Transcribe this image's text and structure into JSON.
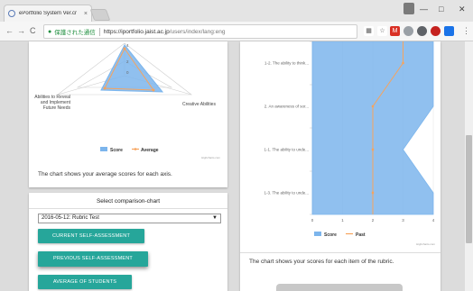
{
  "browser": {
    "tab_title": "ePortfolio System Ver.cr",
    "tab_close": "×",
    "minimize": "—",
    "maximize": "□",
    "close": "✕",
    "back": "←",
    "forward": "→",
    "reload": "C",
    "secure_label": "保護された通信",
    "url_host": "https://iportfolio.jaist.ac.jp",
    "url_path": "/users/index/lang:eng",
    "menu": "⋮"
  },
  "radar_card": {
    "labels": [
      "Abilities to Reveal and Implement Future Needs",
      "Creative Abilities"
    ],
    "label_lines_left": [
      "Abilities to Reveal",
      "and Implement",
      "Future Needs"
    ],
    "label_right": "Creative Abilities",
    "tick_labels": [
      "4",
      "2",
      "0"
    ],
    "legend": [
      {
        "name": "Score",
        "color": "#7cb5ec"
      },
      {
        "name": "Average",
        "color": "#f7a35c"
      }
    ],
    "credit": "Highcharts.com",
    "caption": "The chart shows your average scores for each axis."
  },
  "compare_card": {
    "title": "Select comparison-chart",
    "selected_option": "2016-05-12: Rubric Test",
    "buttons": [
      "CURRENT SELF-ASSESSMENT",
      "PREVIOUS SELF-ASSESSMENT",
      "AVERAGE OF STUDENTS"
    ]
  },
  "bar_card": {
    "caption": "The chart shows your scores for each item of the rubric.",
    "credit": "Highcharts.com"
  },
  "chart_data": [
    {
      "type": "area",
      "categories": [
        "1-2. The ability to think...",
        "2. An awareness of sor...",
        "1-1. The ability to unde...",
        "1-3. The ability to unde..."
      ],
      "series": [
        {
          "name": "Score",
          "values": [
            4,
            4,
            3,
            4
          ],
          "color": "#7cb5ec"
        },
        {
          "name": "Past",
          "values": [
            3,
            2,
            2,
            2
          ],
          "color": "#f7a35c"
        }
      ],
      "xlim": [
        0,
        4
      ],
      "x_ticks": [
        "0",
        "1",
        "2",
        "3",
        "4"
      ],
      "legend_position": "bottom",
      "orientation": "horizontal"
    }
  ]
}
